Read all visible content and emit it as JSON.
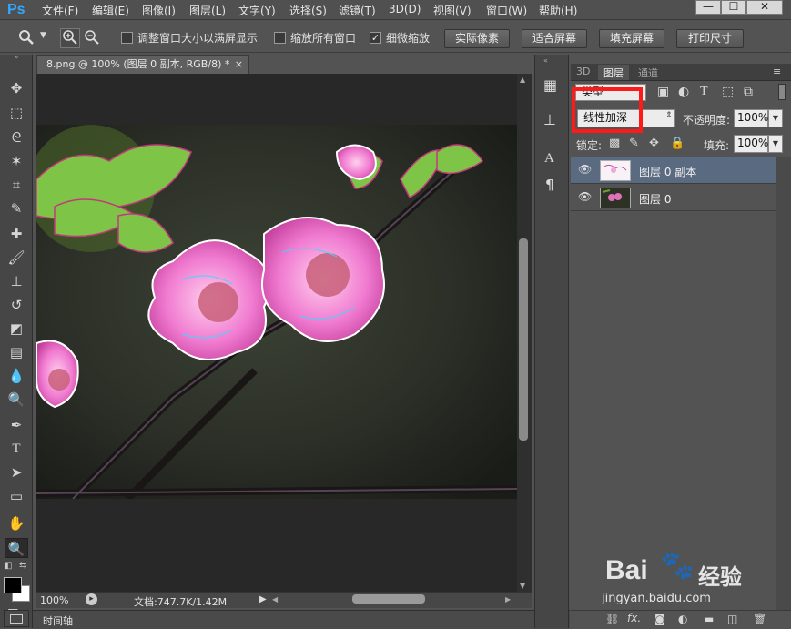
{
  "app": {
    "logo": "Ps",
    "doc_tab": "8.png @ 100% (图层 0 副本, RGB/8) *",
    "close_glyph": "×"
  },
  "menu": [
    "文件(F)",
    "编辑(E)",
    "图像(I)",
    "图层(L)",
    "文字(Y)",
    "选择(S)",
    "滤镜(T)",
    "3D(D)",
    "视图(V)",
    "窗口(W)",
    "帮助(H)"
  ],
  "window_controls": [
    "—",
    "☐",
    "✕"
  ],
  "options": {
    "fit_window": "调整窗口大小以满屏显示",
    "zoom_all": "缩放所有窗口",
    "scrubby": "细微缩放",
    "btn_actual": "实际像素",
    "btn_fit": "适合屏幕",
    "btn_fill": "填充屏幕",
    "btn_print": "打印尺寸"
  },
  "status": {
    "zoom": "100%",
    "doc": "文档:747.7K/1.42M",
    "timeline": "时间轴"
  },
  "panel": {
    "tabs": [
      "3D",
      "图层",
      "通道"
    ],
    "kind_label": "类型",
    "blend_mode": "线性加深",
    "opacity_label": "不透明度:",
    "opacity_value": "100%",
    "lock_label": "锁定:",
    "fill_label": "填充:",
    "fill_value": "100%",
    "layers": [
      {
        "name": "图层 0 副本",
        "selected": true
      },
      {
        "name": "图层 0",
        "selected": false
      }
    ]
  },
  "watermark": {
    "brand": "Bai",
    "brand2": "经验",
    "url": "jingyan.baidu.com"
  },
  "colors": {
    "accent": "#31a8ff",
    "highlight_box": "#ff1a1a",
    "selected_layer": "#5a6a80"
  }
}
